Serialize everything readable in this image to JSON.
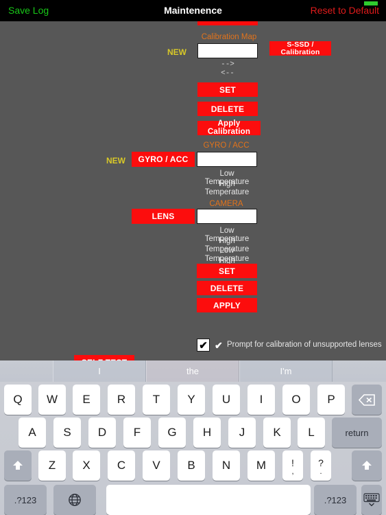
{
  "navbar": {
    "left_button": "Save Log",
    "title": "Maintenence",
    "right_button": "Reset to Default",
    "status_indicator_color": "#2ecc2e"
  },
  "colors": {
    "background": "#575757",
    "red_button": "#fc0d0d",
    "orange_label": "#e2731b",
    "yellow_label": "#d8c828",
    "green_text": "#18c818",
    "red_text": "#e01b1b"
  },
  "calibration_section": {
    "clipped_top_button": "",
    "map_label": "Calibration Map",
    "new_label": "NEW",
    "map_field_value": "",
    "ssd_button": "S-SSD / Calibration",
    "arrow_right": "-->",
    "arrow_left": "<--",
    "set_button": "SET",
    "delete_button": "DELETE",
    "apply_calibration_button": "Apply Calibration"
  },
  "gyro_section": {
    "new_label": "NEW",
    "gyro_button": "GYRO / ACC",
    "header_label": "GYRO / ACC",
    "field_value": "",
    "rows": [
      "Low Temperature",
      "High Temperature"
    ]
  },
  "camera_section": {
    "header_label": "CAMERA",
    "lens_button": "LENS",
    "field_value": "",
    "rows": [
      "Low Temperature",
      "High Temperature",
      "Low Temperature",
      "High Temperature"
    ],
    "set_button": "SET",
    "delete_button": "DELETE",
    "apply_button": "APPLY"
  },
  "prompt_option": {
    "checked": true,
    "check_glyph": "✔",
    "secondary_glyph": "✔",
    "label": "Prompt for calibration of unsupported lenses"
  },
  "self_test": {
    "button": "SELF TEST"
  },
  "keyboard": {
    "suggestions": [
      "I",
      "the",
      "I'm"
    ],
    "row1": [
      "Q",
      "W",
      "E",
      "R",
      "T",
      "Y",
      "U",
      "I",
      "O",
      "P"
    ],
    "row1_special": "backspace-key",
    "row2": [
      "A",
      "S",
      "D",
      "F",
      "G",
      "H",
      "J",
      "K",
      "L"
    ],
    "row2_special": "return",
    "row3": [
      "Z",
      "X",
      "C",
      "V",
      "B",
      "N",
      "M"
    ],
    "row3_dual": [
      {
        "top": "!",
        "bot": ","
      },
      {
        "top": "?",
        "bot": "."
      }
    ],
    "row3_shift_left": "shift-key",
    "row3_shift_right": "shift-key",
    "row4": {
      "numeric_left": ".?123",
      "globe": "globe-key",
      "space": "",
      "numeric_right": ".?123",
      "dismiss": "hide-keyboard-key"
    }
  }
}
